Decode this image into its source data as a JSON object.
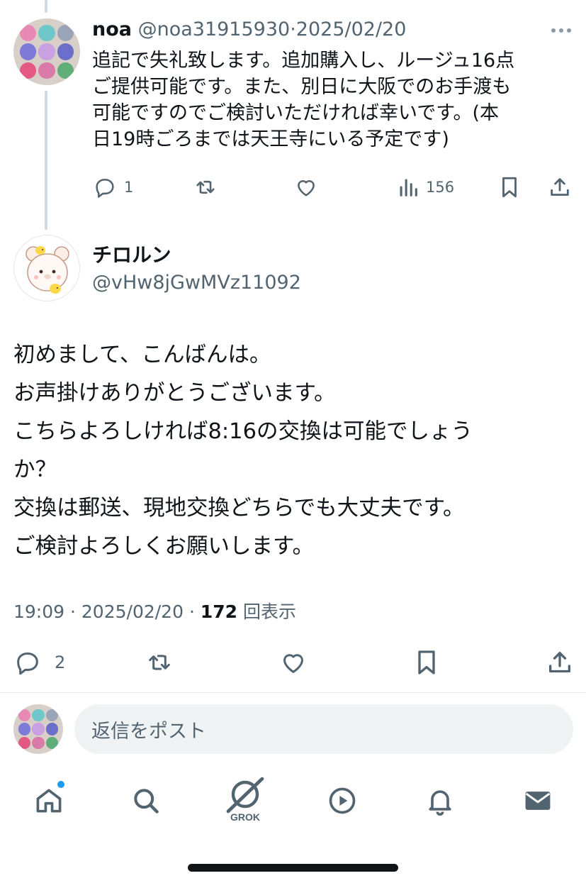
{
  "prev_tweet": {
    "display_name": "noa",
    "handle": "@noa31915930",
    "separator": "·",
    "date": "2025/02/20",
    "more_icon": "more-dots-icon",
    "text": "追記で失礼致します。追加購入し、ルージュ16点\nご提供可能です。また、別日に大阪でのお手渡も\n可能ですのでご検討いただければ幸いです。(本\n日19時ごろまでは天王寺にいる予定です)",
    "actions": {
      "reply_count": "1",
      "retweet_count": "",
      "like_count": "",
      "views_count": "156"
    }
  },
  "main_tweet": {
    "display_name": "チロルン",
    "handle": "@vHw8jGwMVz11092",
    "text": "初めまして、こんばんは。\nお声掛けありがとうございます。\nこちらよろしければ8:16の交換は可能でしょう\nか？\n交換は郵送、現地交換どちらでも大丈夫です。\nご検討よろしくお願いします。",
    "meta": {
      "time": "19:09",
      "sep1": "·",
      "date": "2025/02/20",
      "sep2": "·",
      "views": "172",
      "views_label": "回表示"
    },
    "actions": {
      "reply_count": "2"
    }
  },
  "reply_composer": {
    "placeholder": "返信をポスト"
  },
  "bottom_nav": {
    "items": [
      {
        "icon": "home-icon",
        "has_dot": true
      },
      {
        "icon": "search-icon"
      },
      {
        "icon": "grok-icon",
        "label": "GROK"
      },
      {
        "icon": "video-play-icon"
      },
      {
        "icon": "bell-icon"
      },
      {
        "icon": "mail-icon"
      }
    ],
    "grok_label": "GROK"
  },
  "colors": {
    "text": "#0f1419",
    "muted": "#536471",
    "accent": "#1d9bf0",
    "thread_line": "#cfd9de",
    "composer_bg": "#eff3f4"
  }
}
